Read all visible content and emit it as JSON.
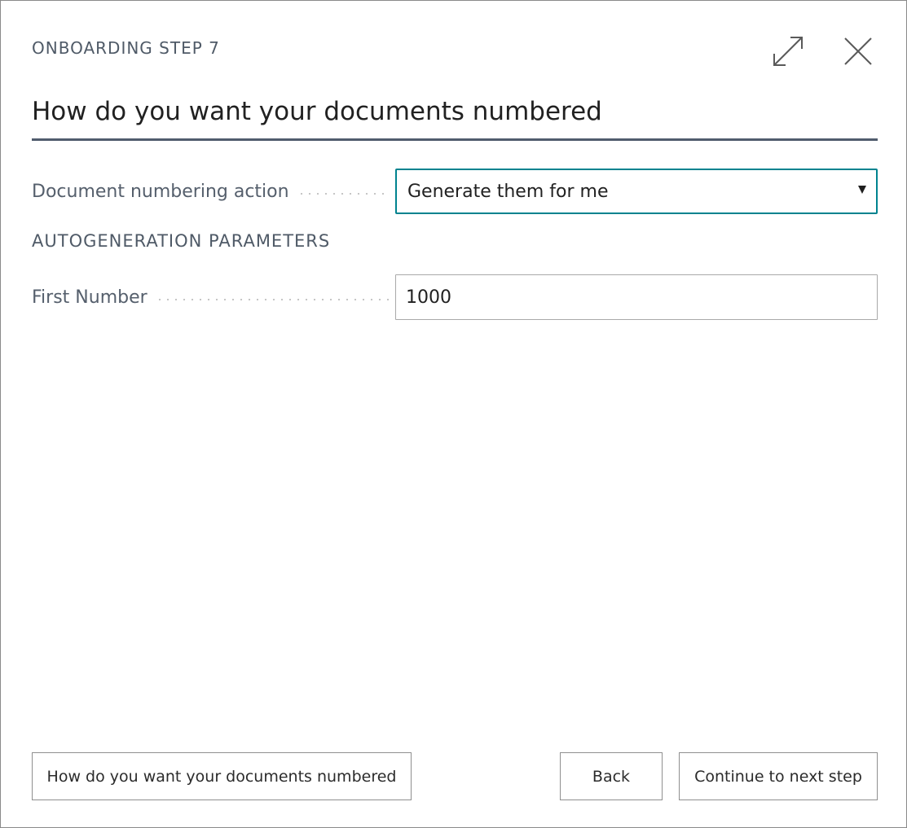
{
  "header": {
    "step_caption": "ONBOARDING STEP 7",
    "expand_icon": "expand-icon",
    "close_icon": "close-icon"
  },
  "page": {
    "title": "How do you want your documents numbered"
  },
  "fields": {
    "numbering_action": {
      "label": "Document numbering action",
      "selected_value": "Generate them for me"
    },
    "section_heading": "AUTOGENERATION PARAMETERS",
    "first_number": {
      "label": "First Number",
      "value": "1000"
    }
  },
  "footer": {
    "step_button_label": "How do you want your documents numbered",
    "back_label": "Back",
    "next_label": "Continue to next step"
  },
  "colors": {
    "accent": "#00838f",
    "title_rule": "#505c6d",
    "muted_text": "#555f6c"
  }
}
